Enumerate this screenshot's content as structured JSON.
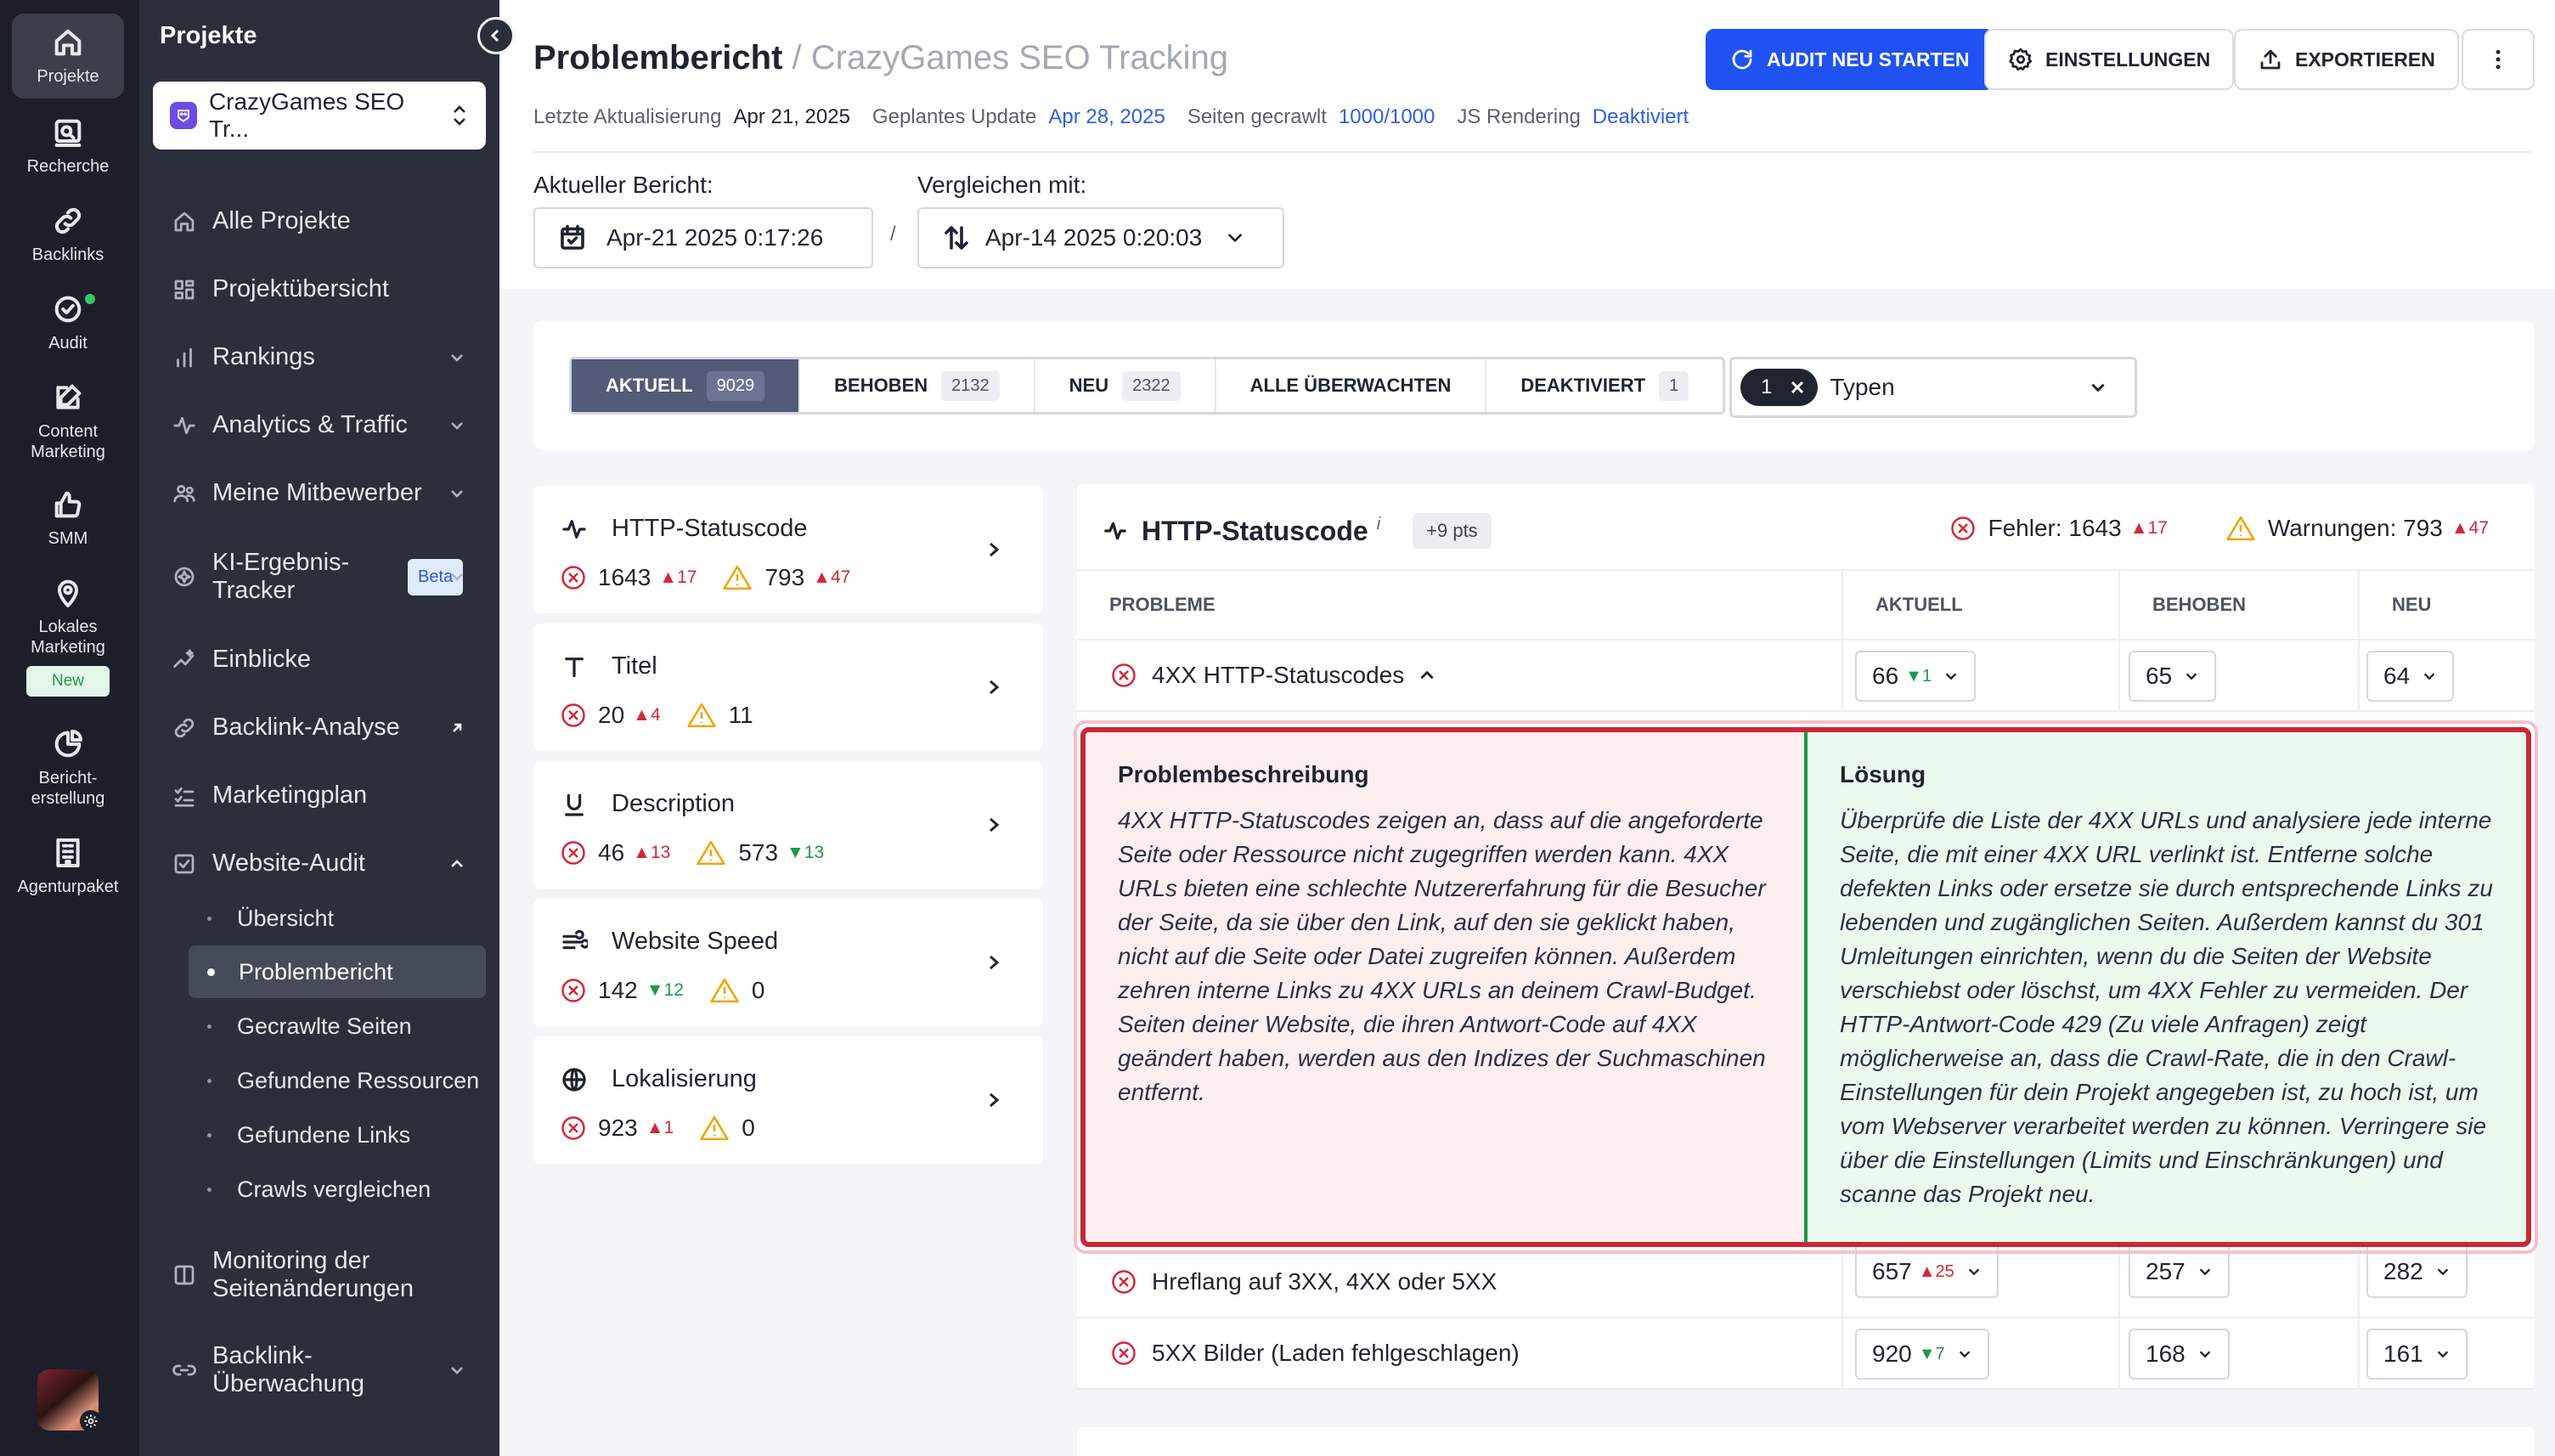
{
  "rail": {
    "items": [
      {
        "label": "Projekte",
        "icon": "home-icon"
      },
      {
        "label": "Recherche",
        "icon": "research-icon"
      },
      {
        "label": "Backlinks",
        "icon": "link-icon"
      },
      {
        "label": "Audit",
        "icon": "audit-check-icon"
      },
      {
        "label": "Content Marketing",
        "icon": "content-edit-icon"
      },
      {
        "label": "SMM",
        "icon": "thumbs-up-icon"
      },
      {
        "label": "Lokales Marketing",
        "icon": "location-pin-icon"
      },
      {
        "label": "Bericht-erstellung",
        "icon": "report-icon"
      },
      {
        "label": "Agenturpaket",
        "icon": "building-icon"
      }
    ],
    "new_badge": "New"
  },
  "sidebar": {
    "title": "Projekte",
    "project_name": "CrazyGames SEO Tr...",
    "items": [
      {
        "label": "Alle Projekte"
      },
      {
        "label": "Projektübersicht"
      },
      {
        "label": "Rankings"
      },
      {
        "label": "Analytics & Traffic"
      },
      {
        "label": "Meine Mitbewerber"
      },
      {
        "label": "KI-Ergebnis-Tracker",
        "badge": "Beta"
      },
      {
        "label": "Einblicke"
      },
      {
        "label": "Backlink-Analyse"
      },
      {
        "label": "Marketingplan"
      },
      {
        "label": "Website-Audit"
      },
      {
        "label": "Monitoring der Seitenänderungen"
      },
      {
        "label": "Backlink-Überwachung"
      }
    ],
    "audit_sub": [
      {
        "label": "Übersicht"
      },
      {
        "label": "Problembericht"
      },
      {
        "label": "Gecrawlte Seiten"
      },
      {
        "label": "Gefundene Ressourcen"
      },
      {
        "label": "Gefundene Links"
      },
      {
        "label": "Crawls vergleichen"
      }
    ]
  },
  "header": {
    "title": "Problembericht",
    "subtitle": "/ CrazyGames SEO Tracking",
    "meta": {
      "last_update_label": "Letzte Aktualisierung",
      "last_update": "Apr 21, 2025",
      "planned_label": "Geplantes Update",
      "planned": "Apr 28, 2025",
      "crawled_label": "Seiten gecrawlt",
      "crawled": "1000/1000",
      "js_label": "JS Rendering",
      "js": "Deaktiviert"
    },
    "buttons": {
      "restart": "AUDIT NEU STARTEN",
      "settings": "EINSTELLUNGEN",
      "export": "EXPORTIEREN"
    },
    "current_label": "Aktueller Bericht:",
    "current_date": "Apr-21 2025 0:17:26",
    "compare_label": "Vergleichen mit:",
    "compare_date": "Apr-14 2025 0:20:03",
    "separator": "/"
  },
  "tabs": [
    {
      "label": "AKTUELL",
      "count": "9029"
    },
    {
      "label": "BEHOBEN",
      "count": "2132"
    },
    {
      "label": "NEU",
      "count": "2322"
    },
    {
      "label": "ALLE ÜBERWACHTEN",
      "count": ""
    },
    {
      "label": "DEAKTIVIERT",
      "count": "1"
    }
  ],
  "types_filter": {
    "count": "1",
    "label": "Typen"
  },
  "cards": [
    {
      "title": "HTTP-Statuscode",
      "icon": "pulse-icon",
      "errors": "1643",
      "errors_delta": "17",
      "errors_dir": "up",
      "warnings": "793",
      "warnings_delta": "47",
      "warnings_dir": "up"
    },
    {
      "title": "Titel",
      "icon": "title-t-icon",
      "errors": "20",
      "errors_delta": "4",
      "errors_dir": "up",
      "warnings": "11",
      "warnings_delta": "",
      "warnings_dir": ""
    },
    {
      "title": "Description",
      "icon": "underline-icon",
      "errors": "46",
      "errors_delta": "13",
      "errors_dir": "up",
      "warnings": "573",
      "warnings_delta": "13",
      "warnings_dir": "down"
    },
    {
      "title": "Website Speed",
      "icon": "speed-lines-icon",
      "errors": "142",
      "errors_delta": "12",
      "errors_dir": "down",
      "warnings": "0",
      "warnings_delta": "",
      "warnings_dir": ""
    },
    {
      "title": "Lokalisierung",
      "icon": "globe-icon",
      "errors": "923",
      "errors_delta": "1",
      "errors_dir": "up",
      "warnings": "0",
      "warnings_delta": "",
      "warnings_dir": ""
    }
  ],
  "panel": {
    "title": "HTTP-Statuscode",
    "info": "i",
    "pts": "+9 pts",
    "errors_label": "Fehler: 1643",
    "errors_delta": "17",
    "warnings_label": "Warnungen: 793",
    "warnings_delta": "47",
    "columns": [
      "PROBLEME",
      "AKTUELL",
      "BEHOBEN",
      "NEU"
    ],
    "rows": [
      {
        "name": "4XX HTTP-Statuscodes",
        "current": "66",
        "delta": "1",
        "dir": "down",
        "fixed": "65",
        "new": "64"
      },
      {
        "name": "Hreflang auf 3XX, 4XX oder 5XX",
        "current": "657",
        "delta": "25",
        "dir": "up",
        "fixed": "257",
        "new": "282"
      },
      {
        "name": "5XX Bilder (Laden fehlgeschlagen)",
        "current": "920",
        "delta": "7",
        "dir": "down",
        "fixed": "168",
        "new": "161"
      }
    ]
  },
  "description": {
    "problem_title": "Problembeschreibung",
    "problem_text": "4XX HTTP-Statuscodes zeigen an, dass auf die angeforderte Seite oder Ressource nicht zugegriffen werden kann. 4XX URLs bieten eine schlechte Nutzererfahrung für die Besucher der Seite, da sie über den Link, auf den sie geklickt haben, nicht auf die Seite oder Datei zugreifen können. Außerdem zehren interne Links zu 4XX URLs an deinem Crawl-Budget. Seiten deiner Website, die ihren Antwort-Code auf 4XX geändert haben, werden aus den Indizes der Suchmaschinen entfernt.",
    "solution_title": "Lösung",
    "solution_text": "Überprüfe die Liste der 4XX URLs und analysiere jede interne Seite, die mit einer 4XX URL verlinkt ist. Entferne solche defekten Links oder ersetze sie durch entsprechende Links zu lebenden und zugänglichen Seiten. Außerdem kannst du 301 Umleitungen einrichten, wenn du die Seiten der Website verschiebst oder löschst, um 4XX Fehler zu vermeiden. Der HTTP-Antwort-Code 429 (Zu viele Anfragen) zeigt möglicherweise an, dass die Crawl-Rate, die in den Crawl-Einstellungen für dein Projekt angegeben ist, zu hoch ist, um vom Webserver verarbeitet werden zu können. Verringere sie über die Einstellungen (Limits und Einschränkungen) und scanne das Projekt neu."
  },
  "colors": {
    "primary": "#1f52f0",
    "rail_bg": "#1c1f29",
    "sidebar_bg": "#2b2f3b",
    "error": "#d3283a",
    "success": "#1d9b48",
    "warning": "#f0a500",
    "link_blue": "#2f5fe0"
  }
}
